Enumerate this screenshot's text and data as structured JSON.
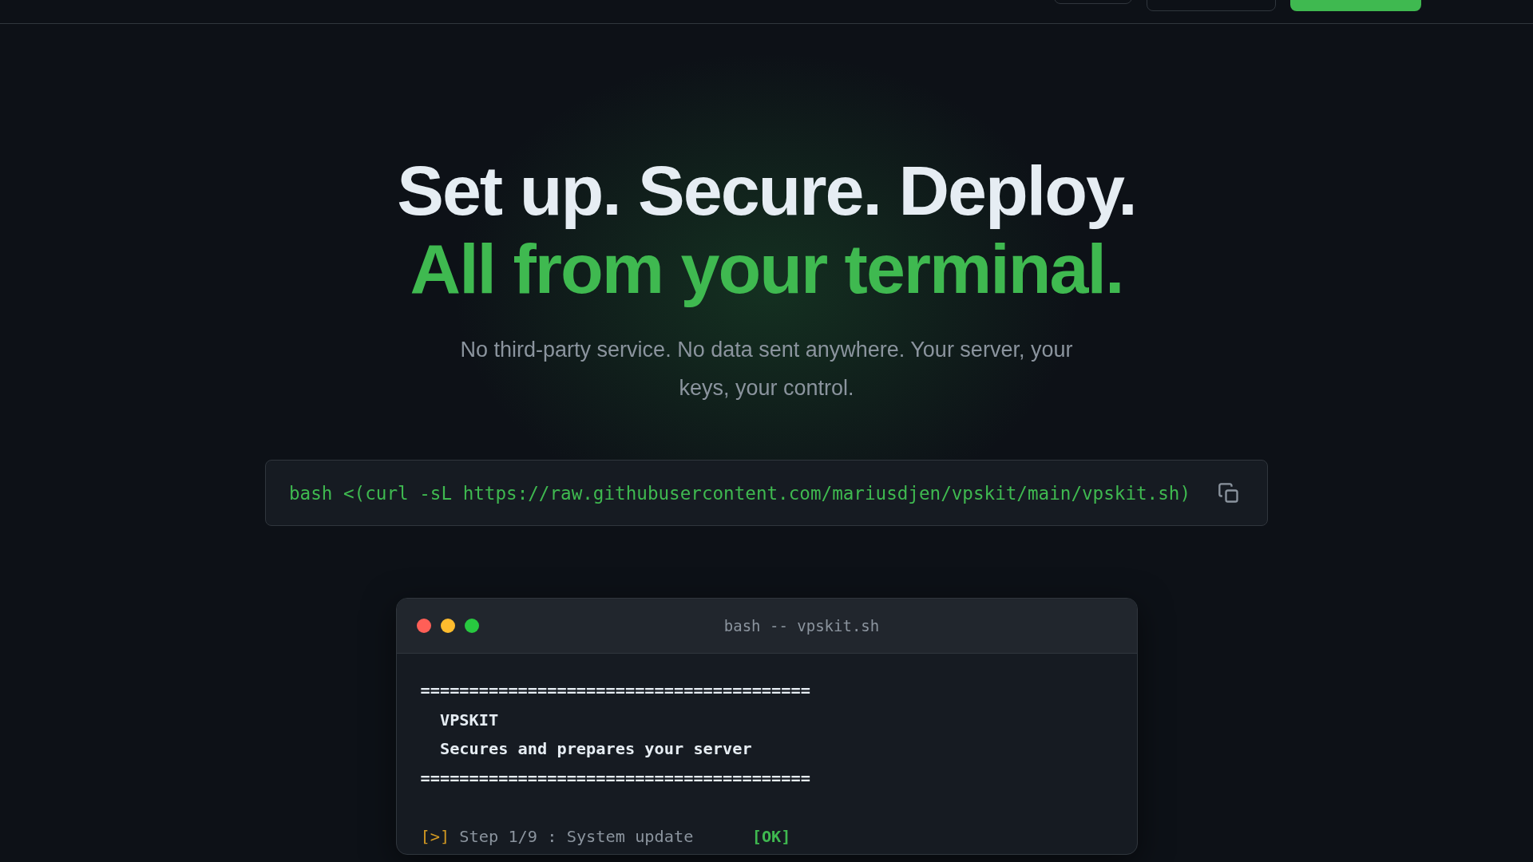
{
  "header": {
    "buttons": [
      {
        "kind": "ghost"
      },
      {
        "kind": "outline"
      },
      {
        "kind": "primary"
      }
    ]
  },
  "hero": {
    "title": "Set up. Secure. Deploy.",
    "highlight": "All from your terminal.",
    "subtitle": "No third-party service. No data sent anywhere. Your server, your keys, your control."
  },
  "install": {
    "command": "bash <(curl -sL https://raw.githubusercontent.com/mariusdjen/vpskit/main/vpskit.sh)"
  },
  "terminal": {
    "title": "bash -- vpskit.sh",
    "lines": [
      {
        "kind": "rule",
        "text": "========================================"
      },
      {
        "kind": "bold",
        "text": "  VPSKIT"
      },
      {
        "kind": "bold",
        "text": "  Secures and prepares your server"
      },
      {
        "kind": "rule",
        "text": "========================================"
      },
      {
        "kind": "blank"
      },
      {
        "kind": "step",
        "prefix": "[>]",
        "text": "Step 1/9 : System update",
        "status": "[OK]"
      }
    ]
  }
}
